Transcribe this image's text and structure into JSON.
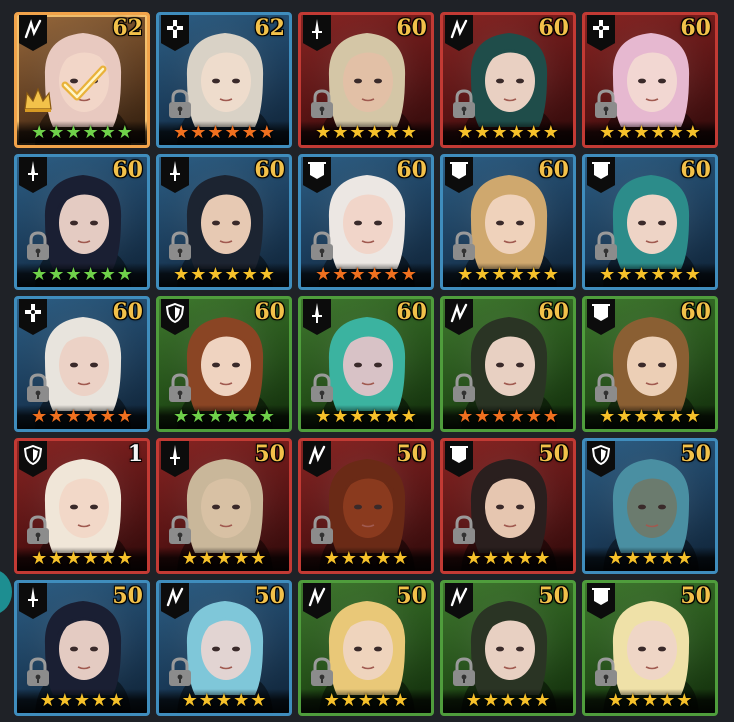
{
  "heroes": [
    {
      "level": "62",
      "cls": "sword-stroke",
      "frame": "selected",
      "stars": 6,
      "star_color": "green",
      "locked": false,
      "crown": true,
      "check": true,
      "hair": "#e8c9c0",
      "skin": "#f2d6c8"
    },
    {
      "level": "62",
      "cls": "cross",
      "frame": "blue",
      "stars": 6,
      "star_color": "orange",
      "locked": true,
      "hair": "#d9d2c6",
      "skin": "#eedccc"
    },
    {
      "level": "60",
      "cls": "dagger",
      "frame": "red",
      "stars": 6,
      "star_color": "gold",
      "locked": true,
      "hair": "#d4c6a6",
      "skin": "#e2c0a6"
    },
    {
      "level": "60",
      "cls": "sword-stroke",
      "frame": "red",
      "stars": 6,
      "star_color": "gold",
      "locked": true,
      "hair": "#1f4d4a",
      "skin": "#e9d0c2"
    },
    {
      "level": "60",
      "cls": "cross",
      "frame": "red",
      "stars": 6,
      "star_color": "gold",
      "locked": true,
      "hair": "#e6b8d0",
      "skin": "#f2d7d2"
    },
    {
      "level": "60",
      "cls": "dagger",
      "frame": "blue",
      "stars": 6,
      "star_color": "green",
      "locked": true,
      "hair": "#1a1f33",
      "skin": "#e4cbc2"
    },
    {
      "level": "60",
      "cls": "dagger",
      "frame": "blue",
      "stars": 6,
      "star_color": "gold",
      "locked": true,
      "hair": "#1c2431",
      "skin": "#e7c9b3"
    },
    {
      "level": "60",
      "cls": "banner",
      "frame": "blue",
      "stars": 6,
      "star_color": "orange",
      "locked": true,
      "hair": "#ece7e3",
      "skin": "#f1d5c9"
    },
    {
      "level": "60",
      "cls": "banner",
      "frame": "blue",
      "stars": 6,
      "star_color": "gold",
      "locked": true,
      "hair": "#cfa86e",
      "skin": "#efd2bb"
    },
    {
      "level": "60",
      "cls": "banner",
      "frame": "blue",
      "stars": 6,
      "star_color": "gold",
      "locked": true,
      "hair": "#2c8c8a",
      "skin": "#eed4c6"
    },
    {
      "level": "60",
      "cls": "cross",
      "frame": "blue",
      "stars": 6,
      "star_color": "orange",
      "locked": true,
      "hair": "#e8e4dd",
      "skin": "#ecd2c6"
    },
    {
      "level": "60",
      "cls": "shield",
      "frame": "green",
      "stars": 6,
      "star_color": "green",
      "locked": true,
      "hair": "#8a4524",
      "skin": "#efd3c0"
    },
    {
      "level": "60",
      "cls": "dagger",
      "frame": "green",
      "stars": 6,
      "star_color": "gold",
      "locked": true,
      "hair": "#3bb3a0",
      "skin": "#d8c2c6"
    },
    {
      "level": "60",
      "cls": "sword-stroke",
      "frame": "green",
      "stars": 6,
      "star_color": "orange",
      "locked": true,
      "hair": "#2a3424",
      "skin": "#e8d0c2"
    },
    {
      "level": "60",
      "cls": "banner",
      "frame": "green",
      "stars": 6,
      "star_color": "gold",
      "locked": true,
      "hair": "#8a5f33",
      "skin": "#eccfb6"
    },
    {
      "level": "1",
      "cls": "shield",
      "frame": "red",
      "stars": 6,
      "star_color": "gold",
      "locked": true,
      "level_color": "white",
      "hair": "#f0e6d8",
      "skin": "#f2d8c8"
    },
    {
      "level": "50",
      "cls": "dagger",
      "frame": "red",
      "stars": 5,
      "star_color": "gold",
      "locked": true,
      "hair": "#c9b79a",
      "skin": "#d8c1a4"
    },
    {
      "level": "50",
      "cls": "sword-stroke",
      "frame": "red",
      "stars": 5,
      "star_color": "gold",
      "locked": true,
      "hair": "#6a2a16",
      "skin": "#8a3a1e"
    },
    {
      "level": "50",
      "cls": "banner",
      "frame": "red",
      "stars": 5,
      "star_color": "gold",
      "locked": true,
      "hair": "#2a1f1e",
      "skin": "#e6c6b0"
    },
    {
      "level": "50",
      "cls": "shield",
      "frame": "blue",
      "stars": 5,
      "star_color": "gold",
      "locked": false,
      "hair": "#4a8fa2",
      "skin": "#6b7b6e"
    },
    {
      "level": "50",
      "cls": "dagger",
      "frame": "blue",
      "stars": 5,
      "star_color": "gold",
      "locked": true,
      "hair": "#1a1f33",
      "skin": "#e4cbc2"
    },
    {
      "level": "50",
      "cls": "sword-stroke",
      "frame": "blue",
      "stars": 5,
      "star_color": "gold",
      "locked": true,
      "hair": "#7fc7d9",
      "skin": "#e2d4d2"
    },
    {
      "level": "50",
      "cls": "sword-stroke",
      "frame": "green",
      "stars": 5,
      "star_color": "gold",
      "locked": true,
      "hair": "#e9c878",
      "skin": "#efd4bd"
    },
    {
      "level": "50",
      "cls": "sword-stroke",
      "frame": "green",
      "stars": 5,
      "star_color": "gold",
      "locked": true,
      "hair": "#2a3424",
      "skin": "#e8d0c2"
    },
    {
      "level": "50",
      "cls": "banner",
      "frame": "green",
      "stars": 5,
      "star_color": "gold",
      "locked": true,
      "hair": "#efe1a8",
      "skin": "#efd6c6"
    }
  ]
}
